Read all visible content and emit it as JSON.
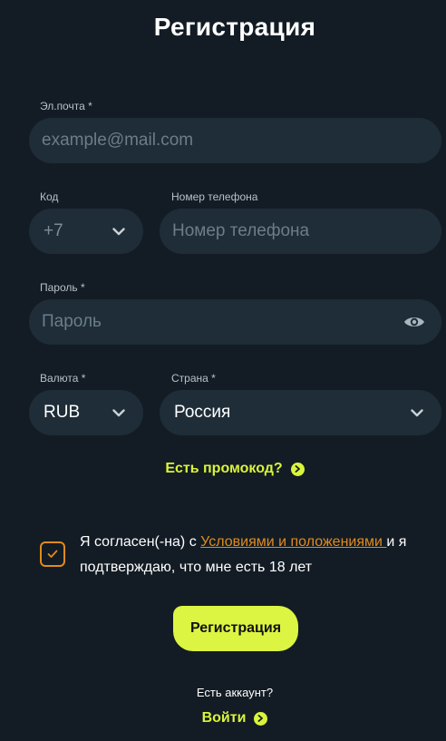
{
  "page": {
    "title": "Регистрация"
  },
  "email": {
    "label": "Эл.почта *",
    "placeholder": "example@mail.com"
  },
  "code": {
    "label": "Код",
    "value": "+7"
  },
  "phone": {
    "label": "Номер телефона",
    "placeholder": "Номер телефона"
  },
  "password": {
    "label": "Пароль *",
    "placeholder": "Пароль"
  },
  "currency": {
    "label": "Валюта *",
    "value": "RUB"
  },
  "country": {
    "label": "Страна *",
    "value": "Россия"
  },
  "promo": {
    "label": "Есть промокод?"
  },
  "consent": {
    "prefix": "Я согласен(-на) с ",
    "link": "Условиями и положениями ",
    "suffix": "и я подтверждаю, что мне есть 18 лет",
    "checked": true
  },
  "register_button": {
    "label": "Регистрация"
  },
  "footer": {
    "question": "Есть аккаунт?",
    "login_label": "Войти"
  },
  "colors": {
    "background": "#131c24",
    "field": "#1e2d38",
    "accent": "#d9f43b",
    "link": "#e08a1e"
  },
  "icons": [
    "chevron-down-icon",
    "eye-icon",
    "arrow-right-circle-icon",
    "check-icon"
  ]
}
